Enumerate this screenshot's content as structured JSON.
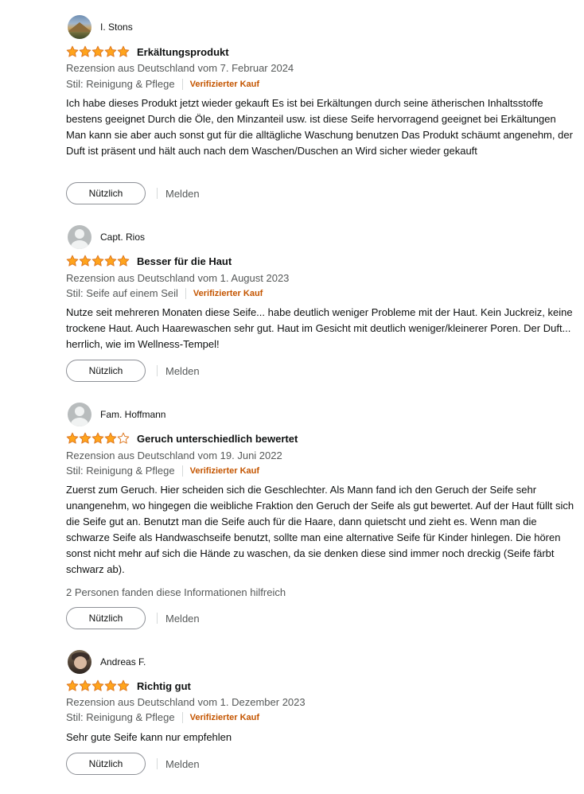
{
  "reviews": [
    {
      "author": "I. Stons",
      "avatar": "landscape-avatar",
      "rating": 5,
      "title": "Erkältungsprodukt",
      "meta": "Rezension aus Deutschland vom 7. Februar 2024",
      "style": "Stil: Reinigung & Pflege",
      "verified": "Verifizierter Kauf",
      "body": "Ich habe dieses Produkt jetzt wieder gekauft Es ist bei Erkältungen durch seine ätherischen Inhaltsstoffe bestens geeignet Durch die Öle, den Minzanteil usw. ist diese Seife hervorragend geeignet bei Erkältungen Man kann sie aber auch sonst gut für die alltägliche Waschung benutzen Das Produkt schäumt angenehm, der Duft ist präsent und hält auch nach dem Waschen/Duschen an Wird sicher wieder gekauft",
      "helpful_label": "Nützlich",
      "report_label": "Melden"
    },
    {
      "author": "Capt. Rios",
      "avatar": "default-avatar",
      "rating": 5,
      "title": "Besser für die Haut",
      "meta": "Rezension aus Deutschland vom 1. August 2023",
      "style": "Stil: Seife auf einem Seil",
      "verified": "Verifizierter Kauf",
      "body": "Nutze seit mehreren Monaten diese Seife... habe deutlich weniger Probleme mit der Haut. Kein Juckreiz, keine trockene Haut. Auch Haarewaschen sehr gut. Haut im Gesicht mit deutlich weniger/kleinerer Poren. Der Duft... herrlich, wie im Wellness-Tempel!",
      "helpful_label": "Nützlich",
      "report_label": "Melden"
    },
    {
      "author": "Fam. Hoffmann",
      "avatar": "default-avatar",
      "rating": 4,
      "title": "Geruch unterschiedlich bewertet",
      "meta": "Rezension aus Deutschland vom 19. Juni 2022",
      "style": "Stil: Reinigung & Pflege",
      "verified": "Verifizierter Kauf",
      "body": "Zuerst zum Geruch. Hier scheiden sich die Geschlechter. Als Mann fand ich den Geruch der Seife sehr unangenehm, wo hingegen die weibliche Fraktion den Geruch der Seife als gut bewertet. Auf der Haut füllt sich die Seife gut an. Benutzt man die Seife auch für die Haare, dann quietscht und zieht es. Wenn man die schwarze Seife als Handwaschseife benutzt, sollte man eine alternative Seife für Kinder hinlegen. Die hören sonst nicht mehr auf sich die Hände zu waschen, da sie denken diese sind immer noch dreckig (Seife färbt schwarz ab).",
      "helpful_count": "2 Personen fanden diese Informationen hilfreich",
      "helpful_label": "Nützlich",
      "report_label": "Melden"
    },
    {
      "author": "Andreas F.",
      "avatar": "portrait-avatar",
      "rating": 5,
      "title": "Richtig gut",
      "meta": "Rezension aus Deutschland vom 1. Dezember 2023",
      "style": "Stil: Reinigung & Pflege",
      "verified": "Verifizierter Kauf",
      "body": "Sehr gute Seife kann nur empfehlen",
      "helpful_label": "Nützlich",
      "report_label": "Melden"
    }
  ],
  "colors": {
    "star_fill": "#ffa41c",
    "star_stroke": "#de7921",
    "verified": "#c45500",
    "secondary_text": "#565959"
  }
}
